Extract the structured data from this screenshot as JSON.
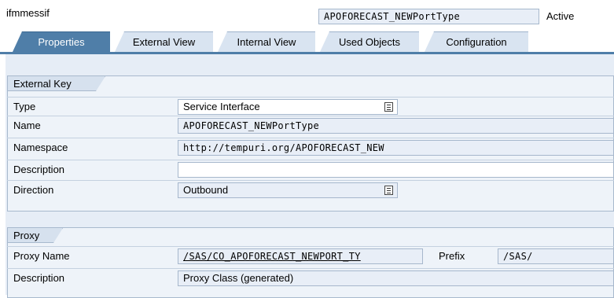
{
  "header": {
    "object_type": "ifmmessif",
    "interface_name": "APOFORECAST_NEWPortType",
    "status": "Active"
  },
  "tabs": [
    {
      "label": "Properties",
      "active": true
    },
    {
      "label": "External View",
      "active": false
    },
    {
      "label": "Internal View",
      "active": false
    },
    {
      "label": "Used Objects",
      "active": false
    },
    {
      "label": "Configuration",
      "active": false
    }
  ],
  "external_key": {
    "title": "External Key",
    "type_label": "Type",
    "type_value": "Service Interface",
    "name_label": "Name",
    "name_value": "APOFORECAST_NEWPortType",
    "namespace_label": "Namespace",
    "namespace_value": "http://tempuri.org/APOFORECAST_NEW",
    "description_label": "Description",
    "description_value": "",
    "direction_label": "Direction",
    "direction_value": "Outbound"
  },
  "proxy": {
    "title": "Proxy",
    "proxy_name_label": "Proxy Name",
    "proxy_name_value": "/SAS/CO_APOFORECAST_NEWPORT_TY",
    "prefix_label": "Prefix",
    "prefix_value": "/SAS/",
    "description_label": "Description",
    "description_value": "Proxy Class (generated)"
  },
  "colors": {
    "active_tab": "#4f7ea8",
    "inactive_tab": "#d9e4f1",
    "panel_bg": "#e6edf6"
  }
}
